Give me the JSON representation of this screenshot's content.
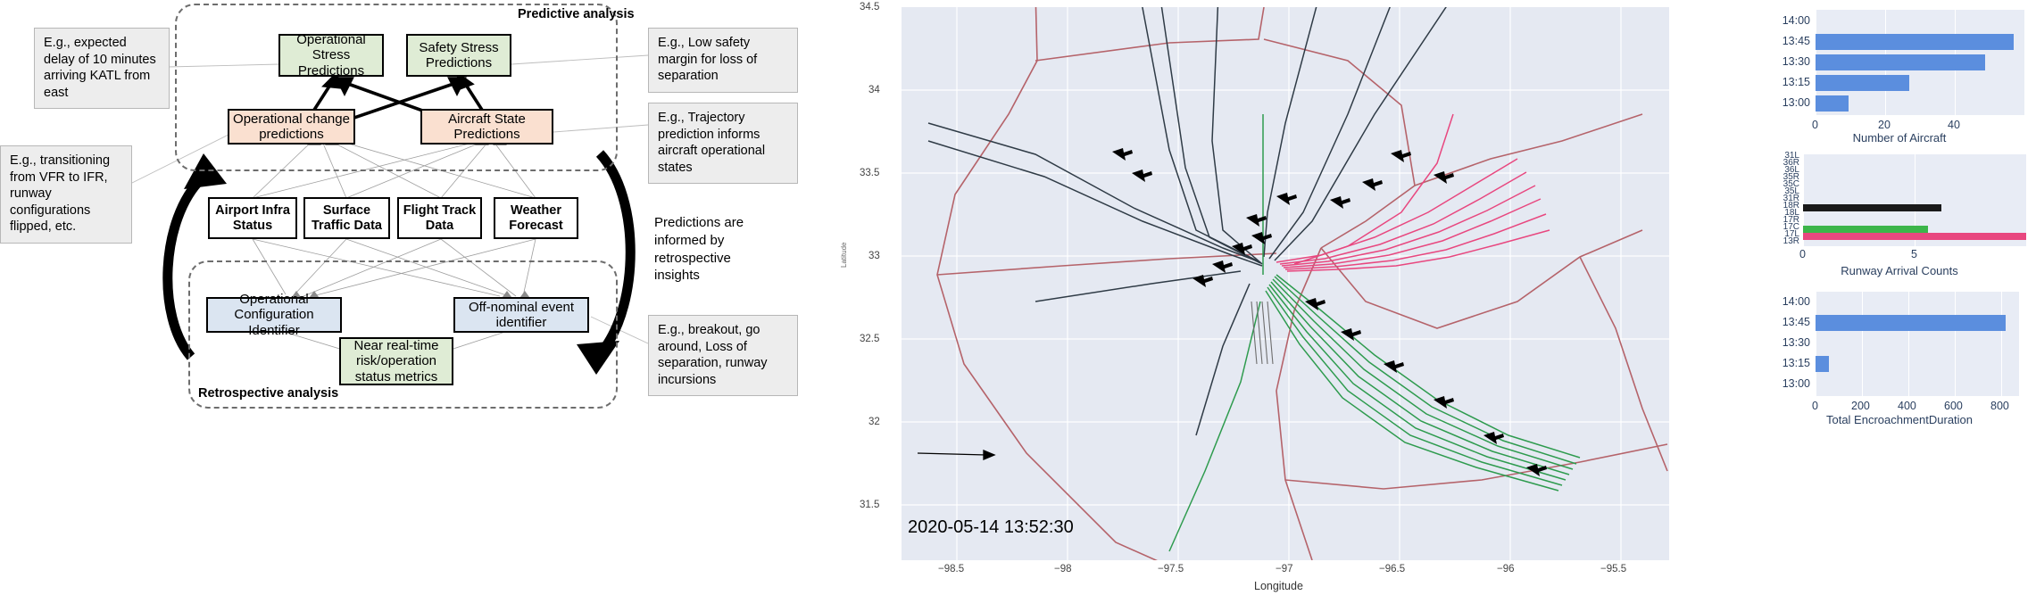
{
  "diagram": {
    "boundaries": {
      "predictive_label": "Predictive analysis",
      "retrospective_label": "Retrospective analysis"
    },
    "nodes": {
      "operational_stress": "Operational\nStress Predictions",
      "safety_stress": "Safety Stress\nPredictions",
      "operational_change": "Operational change\npredictions",
      "aircraft_state": "Aircraft State\nPredictions",
      "airport_infra": "Airport Infra\nStatus",
      "surface_traffic": "Surface\nTraffic Data",
      "flight_track": "Flight Track\nData",
      "weather_forecast": "Weather\nForecast",
      "op_config_identifier": "Operational\nConfiguration Identifier",
      "offnominal_identifier": "Off-nominal event\nidentifier",
      "risk_metrics": "Near real-time\nrisk/operation\nstatus metrics"
    },
    "notes": {
      "delay": "E.g., expected delay of 10 minutes arriving KATL from east",
      "transition": "E.g., transitioning from VFR to IFR, runway configurations flipped, etc.",
      "safety_margin": "E.g., Low safety margin for loss of separation",
      "trajectory": "E.g., Trajectory prediction informs aircraft operational states",
      "informed": "Predictions are informed by retrospective insights",
      "breakout": "E.g., breakout, go around, Loss of separation, runway incursions"
    },
    "colors": {
      "green": "#dfecd5",
      "peach": "#fae0d0",
      "blue": "#dbe5f1",
      "note_bg": "#ededed",
      "boundary": "#6d6d6d"
    }
  },
  "map": {
    "timestamp": "2020-05-14 13:52:30",
    "xlabel": "Longitude",
    "ylabel": "Latitude",
    "xticks": [
      "−98.5",
      "−98",
      "−97.5",
      "−97",
      "−96.5",
      "−96",
      "−95.5"
    ],
    "yticks": [
      "34.5",
      "34",
      "33.5",
      "33",
      "32.5",
      "32",
      "31.5"
    ],
    "xlim": [
      -98.75,
      -95.3
    ],
    "ylim": [
      31.3,
      34.62
    ],
    "plot_bg": "#e5e9f2",
    "series_colors": {
      "sector_boundary": "#b5636a",
      "track_dark": "#2f3b46",
      "track_pink": "#e8477f",
      "track_green": "#2e9b4e"
    }
  },
  "chart_data": [
    {
      "type": "bar",
      "orientation": "horizontal",
      "title": "",
      "xlabel": "Number of Aircraft",
      "ylabel": "",
      "categories": [
        "13:00",
        "13:15",
        "13:30",
        "13:45",
        "14:00"
      ],
      "values": [
        9,
        26,
        47,
        55,
        0
      ],
      "xticks": [
        0,
        20,
        40
      ],
      "xlim": [
        0,
        58
      ],
      "grid": true,
      "bar_color": "#5b8ede",
      "plot_bg": "#e8ecf5"
    },
    {
      "type": "bar",
      "orientation": "horizontal",
      "title": "",
      "xlabel": "Runway Arrival Counts",
      "ylabel": "",
      "categories": [
        "13R",
        "17L",
        "17C",
        "17R",
        "18L",
        "18R",
        "31R",
        "35L",
        "35C",
        "35R",
        "36L",
        "36R",
        "31L"
      ],
      "values": [
        0,
        9.6,
        5.6,
        0,
        0,
        6.2,
        0,
        0,
        0,
        0,
        0,
        0,
        0
      ],
      "bar_colors": [
        "#5b8ede",
        "#e8477f",
        "#3cb54a",
        "#5b8ede",
        "#5b8ede",
        "#1a1a1a",
        "#5b8ede",
        "#5b8ede",
        "#5b8ede",
        "#5b8ede",
        "#5b8ede",
        "#5b8ede",
        "#5b8ede"
      ],
      "xticks": [
        0,
        5
      ],
      "xlim": [
        0,
        10
      ],
      "grid": true,
      "plot_bg": "#e8ecf5"
    },
    {
      "type": "bar",
      "orientation": "horizontal",
      "title": "",
      "xlabel": "Total EncroachmentDuration",
      "ylabel": "",
      "categories": [
        "13:00",
        "13:15",
        "13:30",
        "13:45",
        "14:00"
      ],
      "values": [
        0,
        55,
        0,
        820,
        0
      ],
      "xticks": [
        0,
        200,
        400,
        600,
        800
      ],
      "xlim": [
        0,
        880
      ],
      "grid": true,
      "bar_color": "#5b8ede",
      "plot_bg": "#e8ecf5"
    }
  ]
}
